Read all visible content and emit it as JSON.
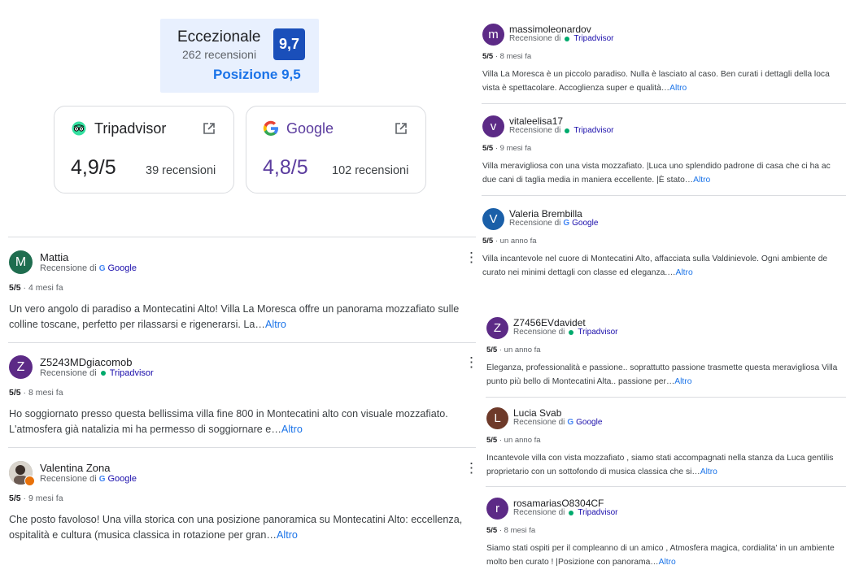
{
  "summary": {
    "label": "Eccezionale",
    "reviews": "262 recensioni",
    "score": "9,7",
    "position": "Posizione 9,5"
  },
  "platforms": [
    {
      "name": "Tripadvisor",
      "rating": "4,9/5",
      "count": "39 recensioni",
      "icon": "tripadvisor-logo-icon",
      "rating_color": "#202124"
    },
    {
      "name": "Google",
      "rating": "4,8/5",
      "count": "102 recensioni",
      "icon": "google-logo-icon",
      "rating_color": "#5b3c9e"
    }
  ],
  "left_reviews": [
    {
      "initial": "M",
      "avatar_color": "#1f6d4f",
      "name": "Mattia",
      "source_prefix": "Recensione di",
      "source": "Google",
      "score": "5/5",
      "time": "· 4 mesi fa",
      "text": "Un vero angolo di paradiso a Montecatini Alto! Villa La Moresca offre un panorama mozzafiato sulle colline toscane, perfetto per rilassarsi e rigenerarsi. La…",
      "more": "Altro"
    },
    {
      "initial": "Z",
      "avatar_color": "#5c2a86",
      "name": "Z5243MDgiacomob",
      "source_prefix": "Recensione di",
      "source": "Tripadvisor",
      "score": "5/5",
      "time": "· 8 mesi fa",
      "text": "Ho soggiornato presso questa bellissima villa fine 800 in Montecatini alto con visuale mozzafiato. L'atmosfera già natalizia mi ha permesso di soggiornare e…",
      "more": "Altro"
    },
    {
      "initial": "",
      "avatar_color": "#8a8a8a",
      "name": "Valentina Zona",
      "source_prefix": "Recensione di",
      "source": "Google",
      "score": "5/5",
      "time": "· 9 mesi fa",
      "text": "Che posto favoloso! Una villa storica con una posizione panoramica su Montecatini Alto: eccellenza, ospitalità e cultura (musica classica in rotazione per gran…",
      "more": "Altro"
    }
  ],
  "right_reviews": [
    {
      "initial": "m",
      "avatar_color": "#5c2a86",
      "name": "massimoleonardov",
      "source_prefix": "Recensione di",
      "source": "Tripadvisor",
      "score": "5/5",
      "time": "· 8 mesi fa",
      "line1": "Villa La Moresca è un piccolo paradiso. Nulla è lasciato al caso. Ben curati i dettagli della loca",
      "line2": "vista è spettacolare. Accoglienza super e qualità…",
      "more": "Altro"
    },
    {
      "initial": "v",
      "avatar_color": "#5c2a86",
      "name": "vitaleelisa17",
      "source_prefix": "Recensione di",
      "source": "Tripadvisor",
      "score": "5/5",
      "time": "· 9 mesi fa",
      "line1": "Villa meravigliosa con una vista mozzafiato. |Luca uno splendido padrone di casa che ci ha ac",
      "line2": "due cani di taglia media in maniera eccellente. |È stato…",
      "more": "Altro"
    },
    {
      "initial": "V",
      "avatar_color": "#1a5fa8",
      "name": "Valeria Brembilla",
      "source_prefix": "Recensione di",
      "source": "Google",
      "score": "5/5",
      "time": "· un anno fa",
      "line1": "Villa incantevole nel cuore di Montecatini Alto, affacciata sulla Valdinievole. Ogni ambiente de",
      "line2": "curato nei minimi dettagli con classe ed eleganza.…",
      "more": "Altro"
    },
    {
      "initial": "Z",
      "avatar_color": "#5c2a86",
      "name": "Z7456EVdavidet",
      "source_prefix": "Recensione di",
      "source": "Tripadvisor",
      "score": "5/5",
      "time": "· un anno fa",
      "line1": "Eleganza, professionalità e passione.. soprattutto passione trasmette questa meravigliosa Villa",
      "line2": "punto più bello di Montecatini Alta.. passione per…",
      "more": "Altro"
    },
    {
      "initial": "L",
      "avatar_color": "#6e3a2a",
      "name": "Lucia Svab",
      "source_prefix": "Recensione di",
      "source": "Google",
      "score": "5/5",
      "time": "· un anno fa",
      "line1": "Incantevole villa con vista mozzafiato , siamo stati accompagnati nella stanza da Luca gentilis",
      "line2": "proprietario con un sottofondo di musica classica che si…",
      "more": "Altro"
    },
    {
      "initial": "r",
      "avatar_color": "#5c2a86",
      "name": "rosamariasO8304CF",
      "source_prefix": "Recensione di",
      "source": "Tripadvisor",
      "score": "5/5",
      "time": "· 8 mesi fa",
      "line1": "Siamo stati ospiti per il compleanno di un amico , Atmosfera magica, cordialita' in un ambiente",
      "line2": "molto ben curato ! |Posizione con panorama…",
      "more": "Altro"
    }
  ]
}
